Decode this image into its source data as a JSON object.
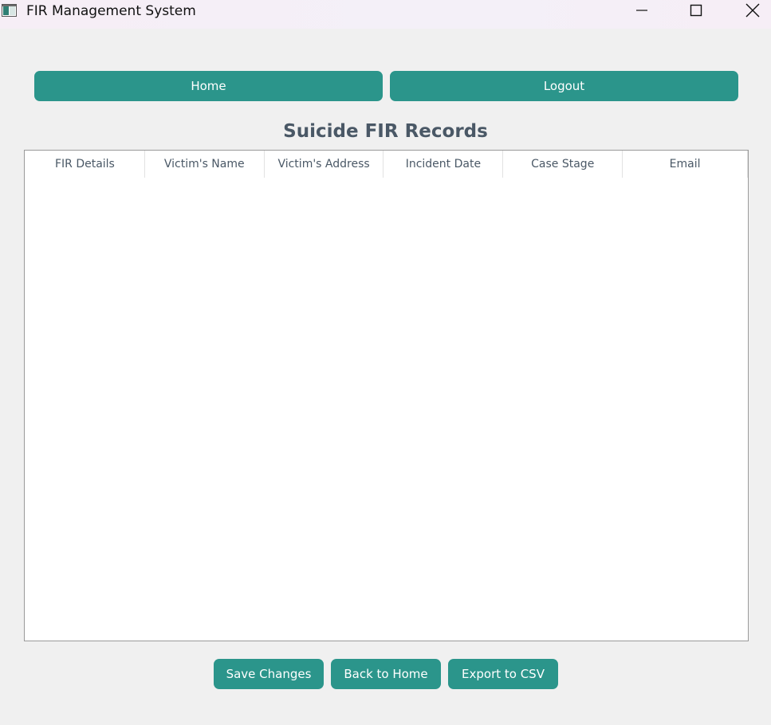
{
  "window": {
    "title": "FIR Management System",
    "icons": {
      "app": "app-window-icon",
      "minimize": "minimize-icon",
      "maximize": "maximize-icon",
      "close": "close-icon"
    }
  },
  "nav": {
    "home_label": "Home",
    "logout_label": "Logout"
  },
  "page": {
    "title": "Suicide FIR Records"
  },
  "table": {
    "columns": [
      "FIR Details",
      "Victim's Name",
      "Victim's Address",
      "Incident Date",
      "Case Stage",
      "Email"
    ],
    "rows": []
  },
  "actions": {
    "save_label": "Save Changes",
    "back_label": "Back to Home",
    "export_label": "Export to CSV"
  },
  "colors": {
    "accent": "#2b958b",
    "heading": "#4a5866",
    "background": "#f0f0f0"
  }
}
